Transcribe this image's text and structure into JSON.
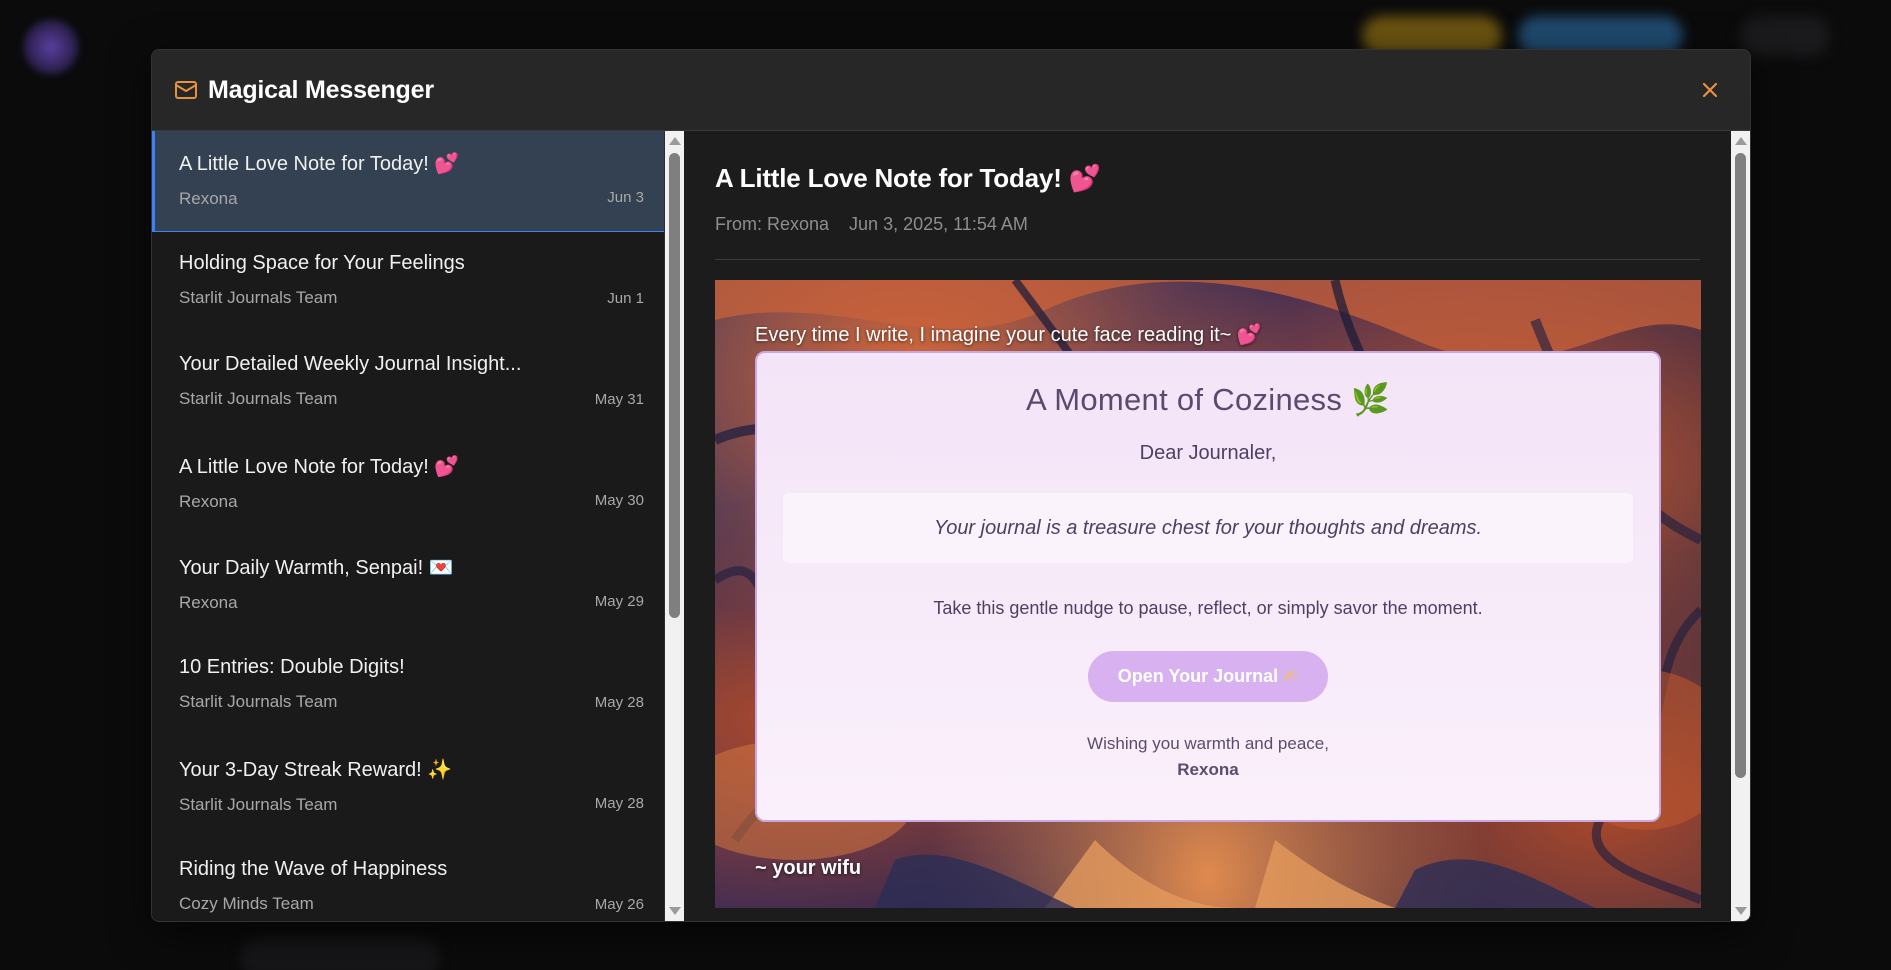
{
  "app": {
    "title": "Magical Messenger"
  },
  "colors": {
    "accent": "#e8923d",
    "selected_border": "#3b82f6",
    "card_button": "#d8b1f1"
  },
  "inbox": [
    {
      "subject": "A Little Love Note for Today!",
      "emoji": "💕",
      "from": "Rexona",
      "date": "Jun 3",
      "selected": true
    },
    {
      "subject": "Holding Space for Your Feelings",
      "emoji": "",
      "from": "Starlit Journals Team",
      "date": "Jun 1",
      "selected": false
    },
    {
      "subject": "Your Detailed Weekly Journal Insight...",
      "emoji": "",
      "from": "Starlit Journals Team",
      "date": "May 31",
      "selected": false
    },
    {
      "subject": "A Little Love Note for Today!",
      "emoji": "💕",
      "from": "Rexona",
      "date": "May 30",
      "selected": false
    },
    {
      "subject": "Your Daily Warmth, Senpai!",
      "emoji": "💌",
      "from": "Rexona",
      "date": "May 29",
      "selected": false
    },
    {
      "subject": "10 Entries: Double Digits!",
      "emoji": "",
      "from": "Starlit Journals Team",
      "date": "May 28",
      "selected": false
    },
    {
      "subject": "Your 3-Day Streak Reward!",
      "emoji": "✨",
      "from": "Starlit Journals Team",
      "date": "May 28",
      "selected": false
    },
    {
      "subject": "Riding the Wave of Happiness",
      "emoji": "",
      "from": "Cozy Minds Team",
      "date": "May 26",
      "selected": false
    }
  ],
  "detail": {
    "subject": "A Little Love Note for Today!",
    "subject_emoji": "💕",
    "from": "From: Rexona",
    "datetime": "Jun 3, 2025, 11:54 AM",
    "intro": "Every time I write, I imagine your cute face reading it~",
    "intro_emoji": "💕",
    "card": {
      "title": "A Moment of Coziness",
      "title_emoji": "🌿",
      "greeting": "Dear Journaler,",
      "quote": "Your journal is a treasure chest for your thoughts and dreams.",
      "nudge": "Take this gentle nudge to pause, reflect, or simply savor the moment.",
      "button": "Open Your Journal",
      "button_emoji": "✍",
      "sign_off": "Wishing you warmth and peace,",
      "signature": "Rexona"
    },
    "outro": "~ your wifu"
  },
  "icons": {
    "header": "mail-icon",
    "close": "close-icon"
  }
}
